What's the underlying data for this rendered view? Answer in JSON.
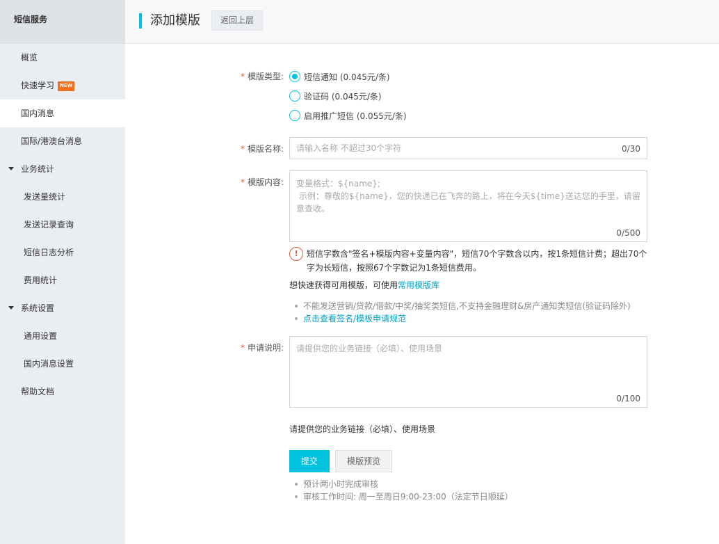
{
  "sidebar": {
    "title": "短信服务",
    "items": [
      {
        "label": "概览"
      },
      {
        "label": "快速学习",
        "badge": "NEW"
      },
      {
        "label": "国内消息"
      },
      {
        "label": "国际/港澳台消息"
      },
      {
        "label": "业务统计"
      },
      {
        "label": "发送量统计"
      },
      {
        "label": "发送记录查询"
      },
      {
        "label": "短信日志分析"
      },
      {
        "label": "费用统计"
      },
      {
        "label": "系统设置"
      },
      {
        "label": "通用设置"
      },
      {
        "label": "国内消息设置"
      },
      {
        "label": "帮助文档"
      }
    ]
  },
  "header": {
    "title": "添加模版",
    "back_label": "返回上层"
  },
  "form": {
    "type_label": "模版类型:",
    "type_options": [
      {
        "label": "短信通知 (0.045元/条)",
        "checked": true
      },
      {
        "label": "验证码 (0.045元/条)",
        "checked": false
      },
      {
        "label": "启用推广短信 (0.055元/条)",
        "checked": false
      }
    ],
    "name_label": "模版名称:",
    "name_placeholder": "请输入名称 不超过30个字符",
    "name_counter": "0/30",
    "content_label": "模版内容:",
    "content_placeholder": "变量格式：${name};\n 示例：尊敬的${name}，您的快递已在飞奔的路上，将在今天${time}送达您的手里，请留意查收。",
    "content_counter": "0/500",
    "warning_icon": "!",
    "warning_text": "短信字数含\"签名+模版内容+变量内容\"，短信70个字数含以内，按1条短信计费；超出70个字为长短信，按照67个字数记为1条短信费用。",
    "library_prefix": "想快速获得可用模版，可使用",
    "library_link": "常用模版库",
    "notes": [
      "不能发送营销/贷款/借款/中奖/抽奖类短信,不支持金融理财&房产通知类短信(验证码除外)"
    ],
    "rule_link": "点击查看签名/模板申请规范",
    "reason_label": "申请说明:",
    "reason_placeholder": "请提供您的业务链接（必填）、使用场景",
    "reason_counter": "0/100",
    "reason_hint": "请提供您的业务链接（必填）、使用场景",
    "submit_label": "提交",
    "preview_label": "模版预览",
    "footer_notes": [
      "预计两小时完成审核",
      "审核工作时间: 周一至周日9:00-23:00（法定节日顺延）"
    ]
  },
  "colors": {
    "accent": "#00c1de",
    "required": "#e2593e",
    "badge": "#f26f21",
    "link": "#00a2ca"
  }
}
